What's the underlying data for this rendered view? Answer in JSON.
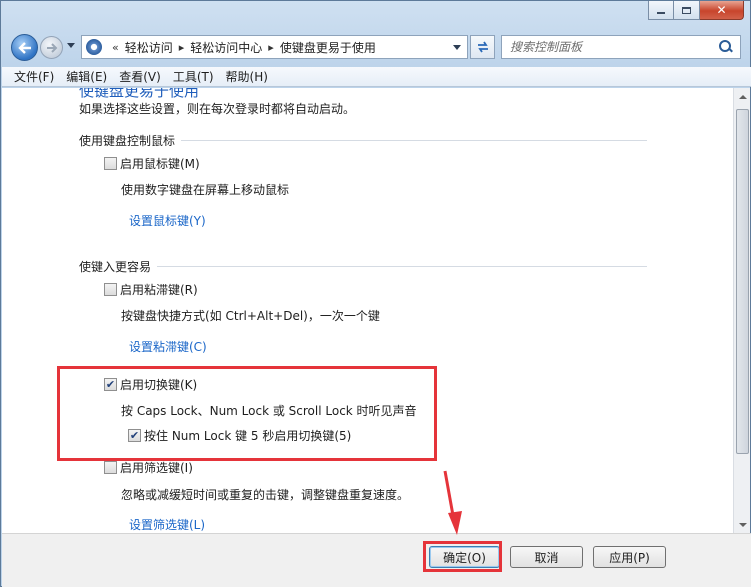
{
  "window": {
    "minimize": "minimize",
    "maximize": "maximize",
    "close": "✕"
  },
  "address_bar": {
    "overflow_symbol": "«",
    "crumbs": [
      "轻松访问",
      "轻松访问中心",
      "使键盘更易于使用"
    ],
    "separator": "▸"
  },
  "search": {
    "placeholder": "搜索控制面板"
  },
  "menu": {
    "items": [
      "文件(F)",
      "编辑(E)",
      "查看(V)",
      "工具(T)",
      "帮助(H)"
    ]
  },
  "content": {
    "cut_heading": "使键盘更易于使用",
    "intro": "如果选择这些设置，则在每次登录时都将自动启动。",
    "section_mouse": {
      "title": "使用键盘控制鼠标",
      "option": {
        "label": "启用鼠标键(M)",
        "checked": false
      },
      "description": "使用数字键盘在屏幕上移动鼠标",
      "link": "设置鼠标键(Y)"
    },
    "section_typing": {
      "title": "使键入更容易",
      "sticky": {
        "label": "启用粘滞键(R)",
        "checked": false,
        "description": "按键盘快捷方式(如 Ctrl+Alt+Del)，一次一个键",
        "link": "设置粘滞键(C)"
      },
      "toggle": {
        "label": "启用切换键(K)",
        "checked": true,
        "description": "按 Caps Lock、Num Lock 或 Scroll Lock 时听见声音",
        "sub_option": {
          "label": "按住 Num Lock 键 5 秒启用切换键(5)",
          "checked": true
        }
      },
      "filter": {
        "label": "启用筛选键(I)",
        "checked": false,
        "description": "忽略或减缓短时间或重复的击键，调整键盘重复速度。",
        "link": "设置筛选键(L)"
      }
    }
  },
  "buttons": {
    "ok": "确定(O)",
    "cancel": "取消",
    "apply": "应用(P)"
  },
  "check_glyph": "✔",
  "colors": {
    "highlight": "#e5343a",
    "link": "#1a66c8"
  }
}
